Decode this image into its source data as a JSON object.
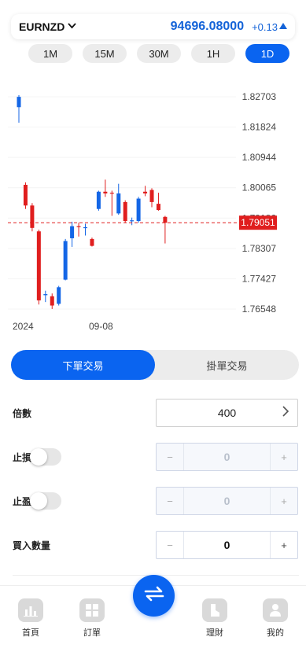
{
  "ticker": {
    "symbol": "EURNZD",
    "price": "94696.08000",
    "change": "+0.13"
  },
  "periods": [
    {
      "label": "1M",
      "active": false
    },
    {
      "label": "15M",
      "active": false
    },
    {
      "label": "30M",
      "active": false
    },
    {
      "label": "1H",
      "active": false
    },
    {
      "label": "1D",
      "active": true
    }
  ],
  "chart_data": {
    "type": "candlestick",
    "y_ticks": [
      "1.82703",
      "1.81824",
      "1.80944",
      "1.80065",
      "1.79186",
      "1.78307",
      "1.77427",
      "1.76548"
    ],
    "x_ticks": [
      "2024",
      "09-08"
    ],
    "current_price_label": "1.79051",
    "current_price": 1.79051,
    "ylim": [
      1.76548,
      1.82703
    ],
    "up_color": "#1466e6",
    "down_color": "#e01e1e",
    "candles": [
      {
        "o": 1.824,
        "c": 1.827,
        "h": 1.8275,
        "l": 1.8195
      },
      {
        "o": 1.8015,
        "c": 1.7955,
        "h": 1.8022,
        "l": 1.7945
      },
      {
        "o": 1.7955,
        "c": 1.789,
        "h": 1.7962,
        "l": 1.788
      },
      {
        "o": 1.788,
        "c": 1.768,
        "h": 1.7885,
        "l": 1.7668
      },
      {
        "o": 1.7695,
        "c": 1.7698,
        "h": 1.7708,
        "l": 1.7675
      },
      {
        "o": 1.7692,
        "c": 1.7665,
        "h": 1.77,
        "l": 1.7655
      },
      {
        "o": 1.767,
        "c": 1.7718,
        "h": 1.7722,
        "l": 1.7665
      },
      {
        "o": 1.774,
        "c": 1.7852,
        "h": 1.7858,
        "l": 1.7738
      },
      {
        "o": 1.786,
        "c": 1.7895,
        "h": 1.7908,
        "l": 1.7835
      },
      {
        "o": 1.7895,
        "c": 1.7893,
        "h": 1.7905,
        "l": 1.7865
      },
      {
        "o": 1.789,
        "c": 1.7892,
        "h": 1.7902,
        "l": 1.7868
      },
      {
        "o": 1.7858,
        "c": 1.7838,
        "h": 1.7862,
        "l": 1.7836
      },
      {
        "o": 1.7945,
        "c": 1.7995,
        "h": 1.7998,
        "l": 1.794
      },
      {
        "o": 1.7995,
        "c": 1.799,
        "h": 1.803,
        "l": 1.798
      },
      {
        "o": 1.7992,
        "c": 1.799,
        "h": 1.7998,
        "l": 1.7925
      },
      {
        "o": 1.7932,
        "c": 1.799,
        "h": 1.8018,
        "l": 1.7928
      },
      {
        "o": 1.7965,
        "c": 1.791,
        "h": 1.797,
        "l": 1.7905
      },
      {
        "o": 1.791,
        "c": 1.7912,
        "h": 1.792,
        "l": 1.7898
      },
      {
        "o": 1.791,
        "c": 1.7975,
        "h": 1.798,
        "l": 1.7905
      },
      {
        "o": 1.7995,
        "c": 1.799,
        "h": 1.8012,
        "l": 1.7982
      },
      {
        "o": 1.8,
        "c": 1.7965,
        "h": 1.8005,
        "l": 1.795
      },
      {
        "o": 1.796,
        "c": 1.7942,
        "h": 1.7992,
        "l": 1.794
      },
      {
        "o": 1.7922,
        "c": 1.7905,
        "h": 1.7925,
        "l": 1.7845
      }
    ]
  },
  "tabs": [
    {
      "label": "下單交易",
      "active": true
    },
    {
      "label": "掛單交易",
      "active": false
    }
  ],
  "form": {
    "leverage": {
      "label": "倍數",
      "value": "400"
    },
    "stop_loss": {
      "label": "止損",
      "value": "0",
      "minus": "−",
      "plus": "+"
    },
    "take_profit": {
      "label": "止盈",
      "value": "0",
      "minus": "−",
      "plus": "+"
    },
    "quantity": {
      "label": "買入數量",
      "value": "0",
      "minus": "−",
      "plus": "+"
    }
  },
  "nav": [
    {
      "label": "首頁",
      "icon": "chart-icon"
    },
    {
      "label": "訂單",
      "icon": "grid-icon"
    },
    {
      "label": "理財",
      "icon": "wallet-icon"
    },
    {
      "label": "我的",
      "icon": "user-icon"
    }
  ],
  "fab": {
    "icon": "swap-arrows-icon"
  }
}
